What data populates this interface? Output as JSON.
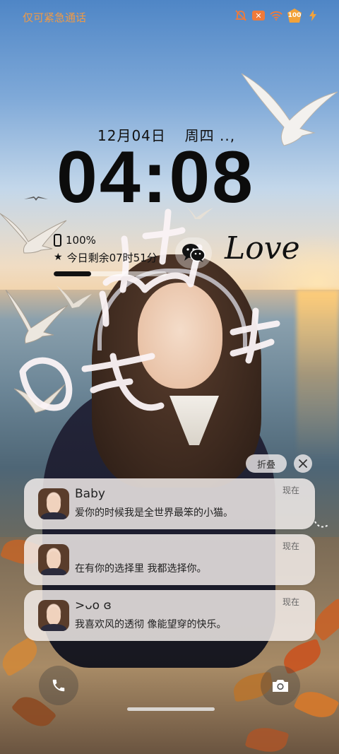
{
  "status_bar": {
    "carrier_text": "仅可紧急通话",
    "battery_level": "100",
    "icons": [
      "mute-icon",
      "no-sim-icon",
      "wifi-icon",
      "battery-icon",
      "charging-icon"
    ]
  },
  "lock_clock": {
    "date": "12月04日",
    "weekday": "周四 ..,",
    "time": "04:08"
  },
  "widget": {
    "phone_battery": "100%",
    "remaining_label": "今日剩余07时51分",
    "remaining_fraction": 0.33
  },
  "wallpaper_text": {
    "love": "Love"
  },
  "notification_group": {
    "fold_label": "折叠",
    "app_icon": "wechat-icon",
    "items": [
      {
        "title": "Baby",
        "time": "现在",
        "text": "爱你的时候我是全世界最笨的小猫。"
      },
      {
        "title": "",
        "time": "现在",
        "text": "在有你的选择里 我都选择你。"
      },
      {
        "title": ">ᴗo ɞ",
        "time": "现在",
        "text": "我喜欢风的透彻 像能望穿的快乐。"
      }
    ]
  },
  "shortcuts": {
    "left": "phone-icon",
    "right": "camera-icon"
  },
  "colors": {
    "carrier_text": "#f09a45",
    "clock_text": "#0c0c0c",
    "notification_bg": "#f4eeec"
  }
}
